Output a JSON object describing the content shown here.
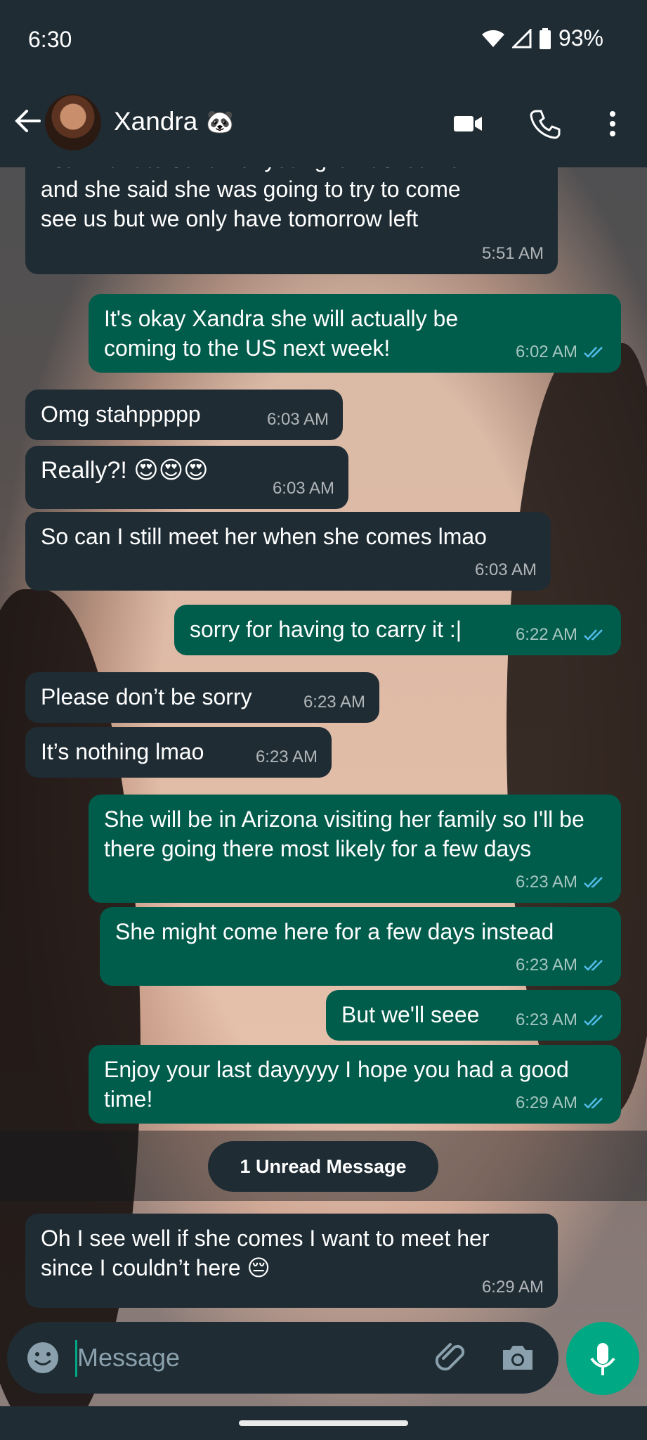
{
  "status": {
    "time": "6:30",
    "battery": "93%"
  },
  "contact": {
    "name": "Xandra",
    "status_emoji": "🐼"
  },
  "messages": [
    {
      "text_lines": [
        "I still want to send her your gift. I asked her",
        "and she said she was going to try to come",
        "see us but we only have tomorrow left"
      ],
      "time": "5:51 AM",
      "dir": "in"
    },
    {
      "text": "It's okay Xandra she will actually be coming to the US next week!",
      "time": "6:02 AM",
      "dir": "out",
      "status": "read"
    },
    {
      "text": "Omg stahppppp",
      "time": "6:03 AM",
      "dir": "in"
    },
    {
      "text": "Really?! 😍😍😍",
      "time": "6:03 AM",
      "dir": "in"
    },
    {
      "text": "So can I still meet her when she comes lmao",
      "time": "6:03 AM",
      "dir": "in"
    },
    {
      "text": "sorry for having to carry it :|",
      "time": "6:22 AM",
      "dir": "out",
      "status": "read"
    },
    {
      "text": "Please don’t be sorry",
      "time": "6:23 AM",
      "dir": "in"
    },
    {
      "text": "It’s nothing lmao",
      "time": "6:23 AM",
      "dir": "in"
    },
    {
      "text": "She will be in Arizona visiting her family so I'll be there going there most likely for a few days",
      "time": "6:23 AM",
      "dir": "out",
      "status": "read"
    },
    {
      "text": "She might come here for a few days instead",
      "time": "6:23 AM",
      "dir": "out",
      "status": "read"
    },
    {
      "text": "But we'll seee",
      "time": "6:23 AM",
      "dir": "out",
      "status": "read"
    },
    {
      "text": "Enjoy your last dayyyyy I hope you had a good time!",
      "time": "6:29 AM",
      "dir": "out",
      "status": "read"
    },
    {
      "text": "Oh I see well if she comes I want to meet her since I couldn’t here 😔",
      "time": "6:29 AM",
      "dir": "in"
    }
  ],
  "unread_banner": "1 Unread Message",
  "composer": {
    "placeholder": "Message"
  },
  "icons": {
    "back": "arrow-left-icon",
    "video": "video-call-icon",
    "call": "phone-icon",
    "menu": "more-vert-icon",
    "emoji": "emoji-icon",
    "attach": "paperclip-icon",
    "camera": "camera-icon",
    "mic": "microphone-icon",
    "read": "double-check-icon",
    "wifi": "wifi-icon",
    "signal": "signal-icon",
    "battery": "battery-icon"
  },
  "colors": {
    "incoming": "#1f2c34",
    "outgoing": "#005c4b",
    "accent": "#00a884",
    "read_tick": "#53bdeb"
  }
}
